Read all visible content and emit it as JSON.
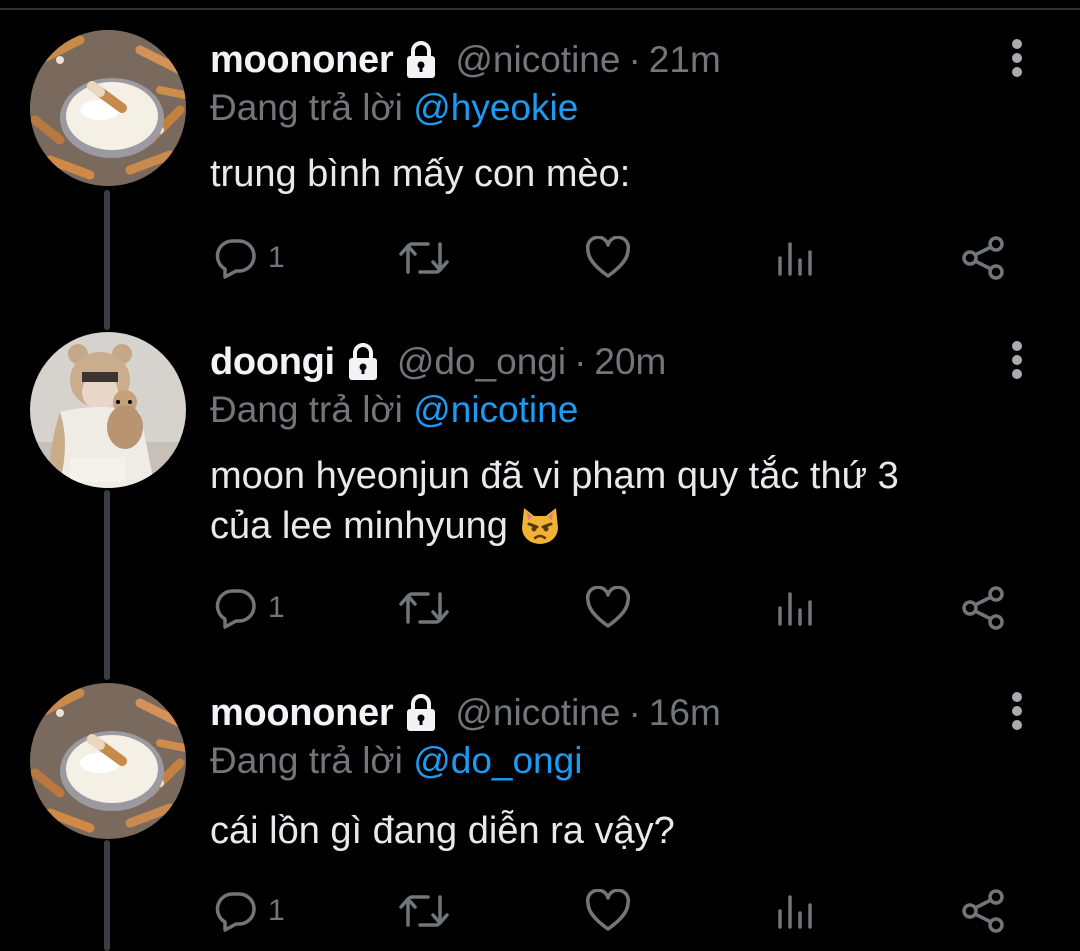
{
  "tweets": [
    {
      "display_name": "moononer",
      "handle": "@nicotine",
      "separator": "·",
      "time": "21m",
      "reply_prefix": "Đang trả lời",
      "reply_to": "@hyeokie",
      "text_lines": [
        "trung bình mấy con mèo:"
      ],
      "reply_count": "1",
      "avatar": "candle-cigarettes-avatar"
    },
    {
      "display_name": "doongi",
      "handle": "@do_ongi",
      "separator": "·",
      "time": "20m",
      "reply_prefix": "Đang trả lời",
      "reply_to": "@nicotine",
      "text_lines": [
        "moon hyeonjun đã vi phạm quy tắc thứ 3",
        "của lee minhyung"
      ],
      "emoji": "pouting-cat-emoji",
      "reply_count": "1",
      "avatar": "person-with-bear-hat-avatar"
    },
    {
      "display_name": "moononer",
      "handle": "@nicotine",
      "separator": "·",
      "time": "16m",
      "reply_prefix": "Đang trả lời",
      "reply_to": "@do_ongi",
      "text_lines": [
        "cái lồn gì đang diễn ra vậy?"
      ],
      "reply_count": "1",
      "avatar": "candle-cigarettes-avatar"
    }
  ],
  "icons": {
    "lock": "lock-icon",
    "more": "more-vertical-icon",
    "reply": "reply-icon",
    "retweet": "retweet-icon",
    "like": "heart-icon",
    "analytics": "analytics-icon",
    "share": "share-icon"
  },
  "colors": {
    "background": "#000000",
    "text": "#e7e9ea",
    "secondary": "#71767b",
    "link": "#1d9bf0",
    "thread_line": "#3a3d41"
  }
}
